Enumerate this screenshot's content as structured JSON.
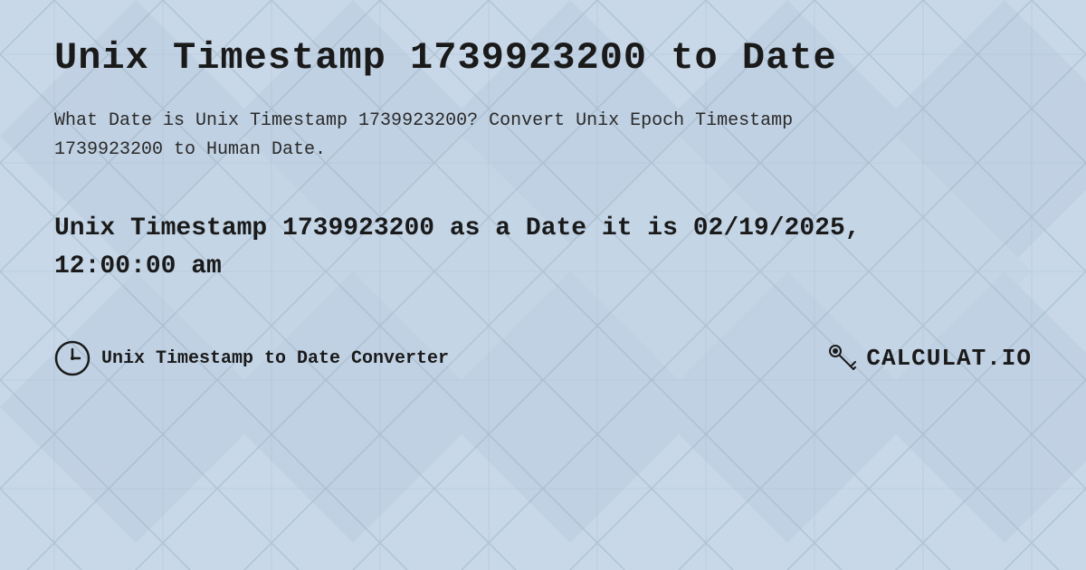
{
  "page": {
    "background_color": "#c8d8e8",
    "title": "Unix Timestamp 1739923200 to Date",
    "description": "What Date is Unix Timestamp 1739923200? Convert Unix Epoch Timestamp 1739923200 to Human Date.",
    "result": "Unix Timestamp 1739923200 as a Date it is 02/19/2025, 12:00:00 am",
    "footer": {
      "link_text": "Unix Timestamp to Date Converter",
      "logo_text": "CALCULAT.IO"
    }
  }
}
